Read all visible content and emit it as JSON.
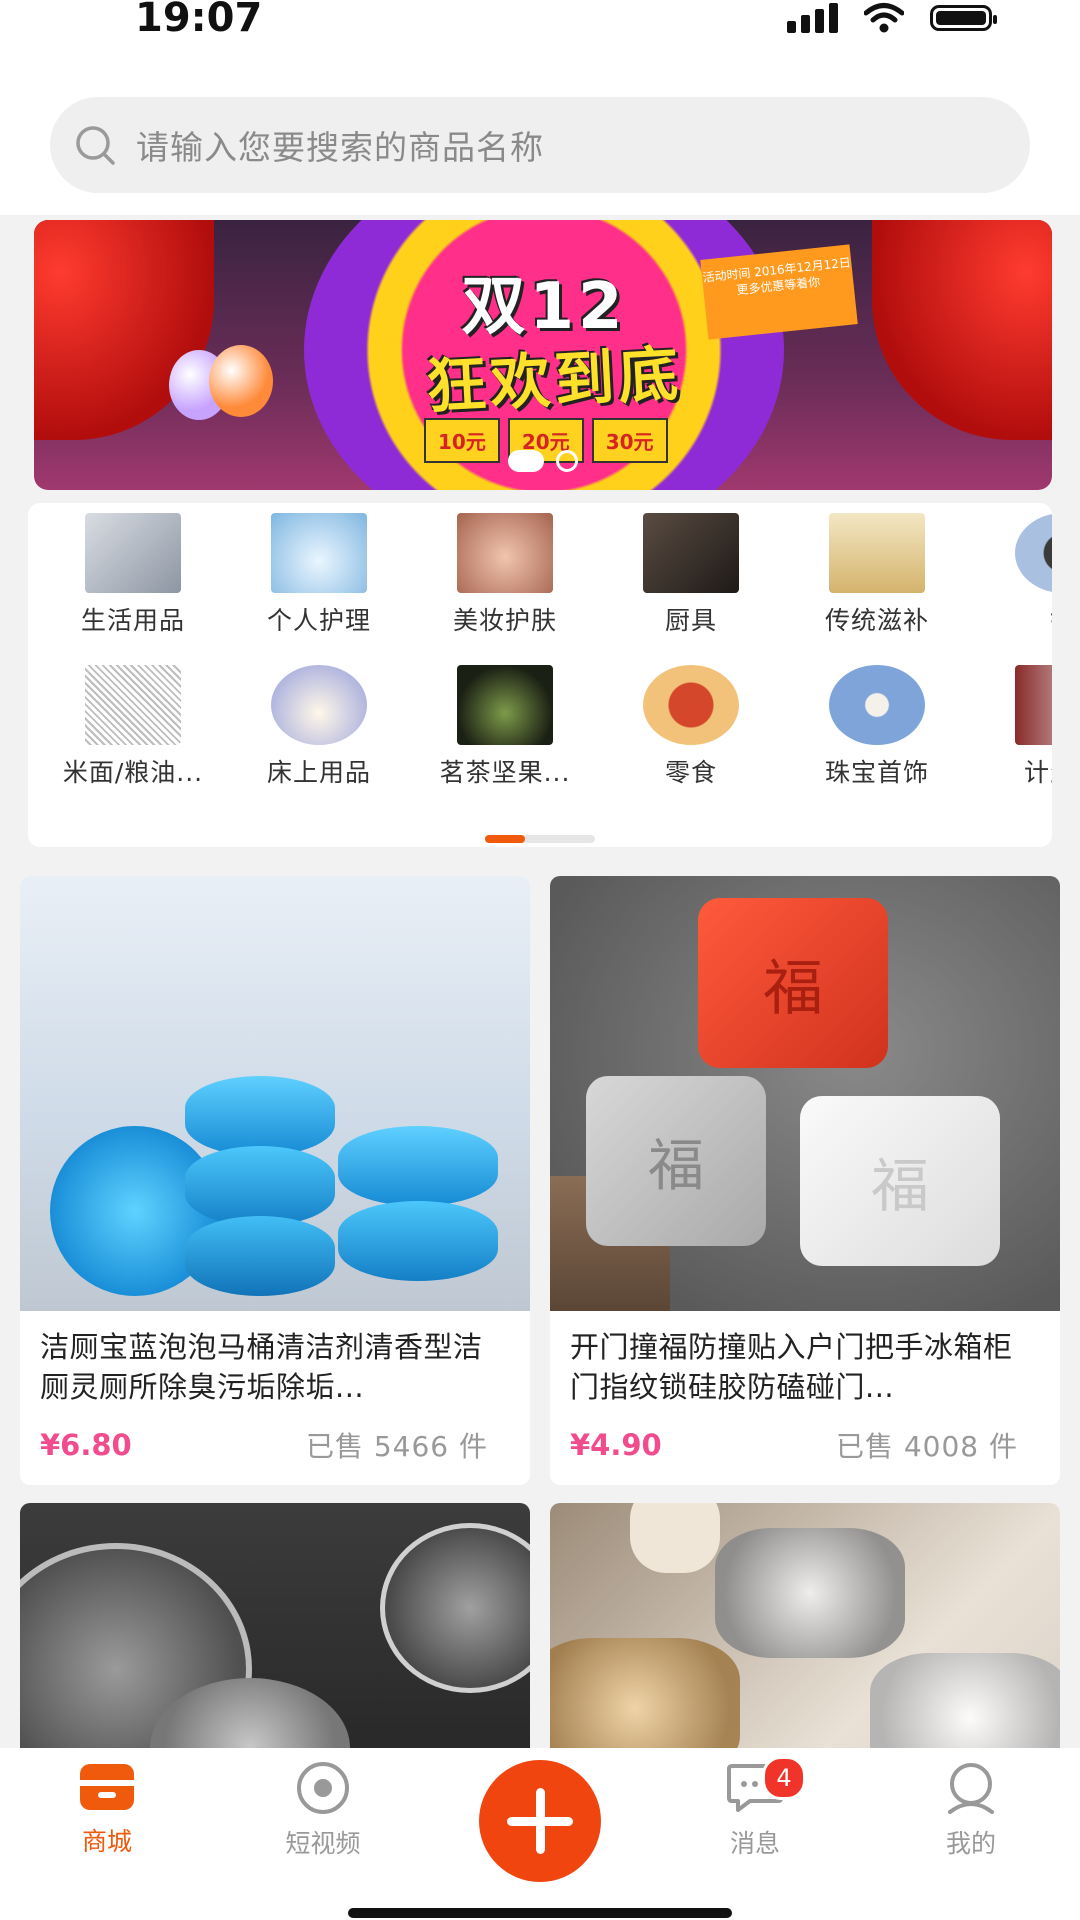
{
  "status_bar": {
    "time": "19:07"
  },
  "search": {
    "placeholder": "请输入您要搜索的商品名称"
  },
  "banner": {
    "title": "双12",
    "subtitle": "狂欢到底",
    "date_tag": "活动时间 2016年12月12日 更多优惠等着你",
    "coupons": [
      "10元",
      "20元",
      "30元"
    ],
    "slide_count": 2,
    "active_slide": 1
  },
  "categories": {
    "row1": [
      {
        "label": "生活用品",
        "icon": "household-photo",
        "color": "#c9ced6"
      },
      {
        "label": "个人护理",
        "icon": "water-drop-photo",
        "color": "#9fc8e8"
      },
      {
        "label": "美妆护肤",
        "icon": "woman-face-photo",
        "color": "#d7a38c"
      },
      {
        "label": "厨具",
        "icon": "kitchenware-photo",
        "color": "#3b3430"
      },
      {
        "label": "传统滋补",
        "icon": "tonic-jars-photo",
        "color": "#e8d7a8"
      },
      {
        "label": "钟",
        "icon": "watch-photo",
        "color": "#9bb6d9"
      }
    ],
    "row2": [
      {
        "label": "米面/粮油...",
        "icon": "sketch-photo",
        "color": "#dddddd"
      },
      {
        "label": "床上用品",
        "icon": "bedding-photo",
        "color": "#b5b9e0"
      },
      {
        "label": "茗茶坚果...",
        "icon": "tea-photo",
        "color": "#2f3a24"
      },
      {
        "label": "零食",
        "icon": "snack-photo",
        "color": "#f0a830"
      },
      {
        "label": "珠宝首饰",
        "icon": "necklace-photo",
        "color": "#7aa2d8"
      },
      {
        "label": "计生用",
        "icon": "product-photo",
        "color": "#a03030"
      }
    ],
    "scroll_progress": 0.36
  },
  "products": [
    {
      "title": "洁厕宝蓝泡泡马桶清洁剂清香型洁厕灵厕所除臭污垢除垢...",
      "price": "¥6.80",
      "sold": "已售 5466 件",
      "image": "blue-toilet-cleaner-photo"
    },
    {
      "title": "开门撞福防撞贴入户门把手冰箱柜门指纹锁硅胶防磕碰门...",
      "price": "¥4.90",
      "sold": "已售 4008 件",
      "image": "fu-door-stopper-photo"
    },
    {
      "title": "",
      "price": "",
      "sold": "",
      "image": "glass-knob-cover-photo"
    },
    {
      "title": "",
      "price": "",
      "sold": "",
      "image": "glass-ashtray-photo"
    }
  ],
  "tabbar": {
    "items": [
      {
        "label": "商城",
        "icon": "shop-icon",
        "active": true
      },
      {
        "label": "短视频",
        "icon": "video-icon",
        "active": false
      },
      {
        "label": "",
        "icon": "plus-icon",
        "active": false
      },
      {
        "label": "消息",
        "icon": "message-icon",
        "active": false,
        "badge": "4"
      },
      {
        "label": "我的",
        "icon": "profile-icon",
        "active": false
      }
    ]
  },
  "colors": {
    "accent": "#f05a0c",
    "price": "#f04c8e",
    "badge": "#f0342a"
  }
}
